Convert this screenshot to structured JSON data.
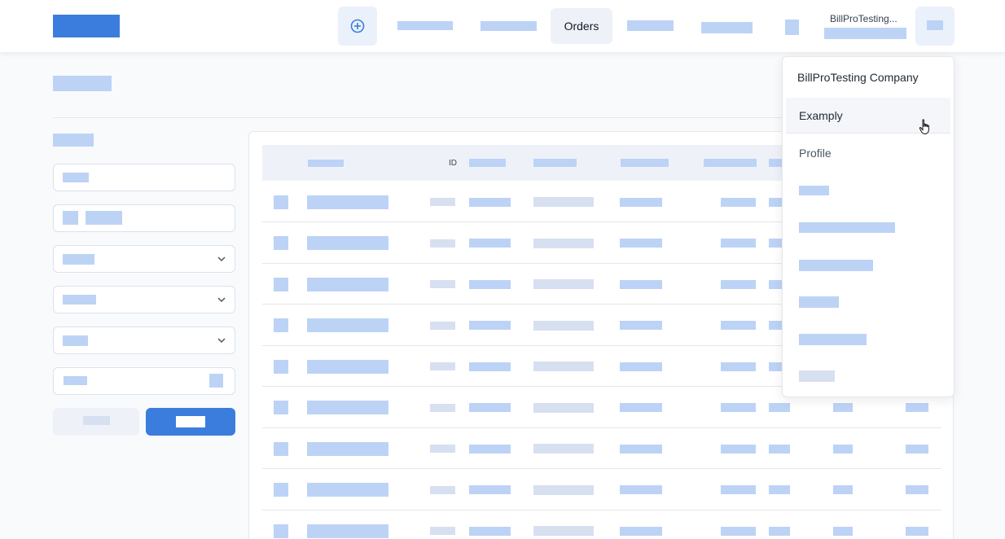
{
  "header": {
    "nav_active_label": "Orders",
    "company_short": "BillProTesting...",
    "icons": {
      "add": "plus-circle-icon"
    }
  },
  "table": {
    "id_header": "ID",
    "row_count": 9
  },
  "account_menu": {
    "company": "BillProTesting Company",
    "active_item": "Examply",
    "profile": "Profile"
  },
  "colors": {
    "accent": "#3b7ddd",
    "placeholder": "#bcd3f6",
    "page_bg": "#f8fafc"
  }
}
